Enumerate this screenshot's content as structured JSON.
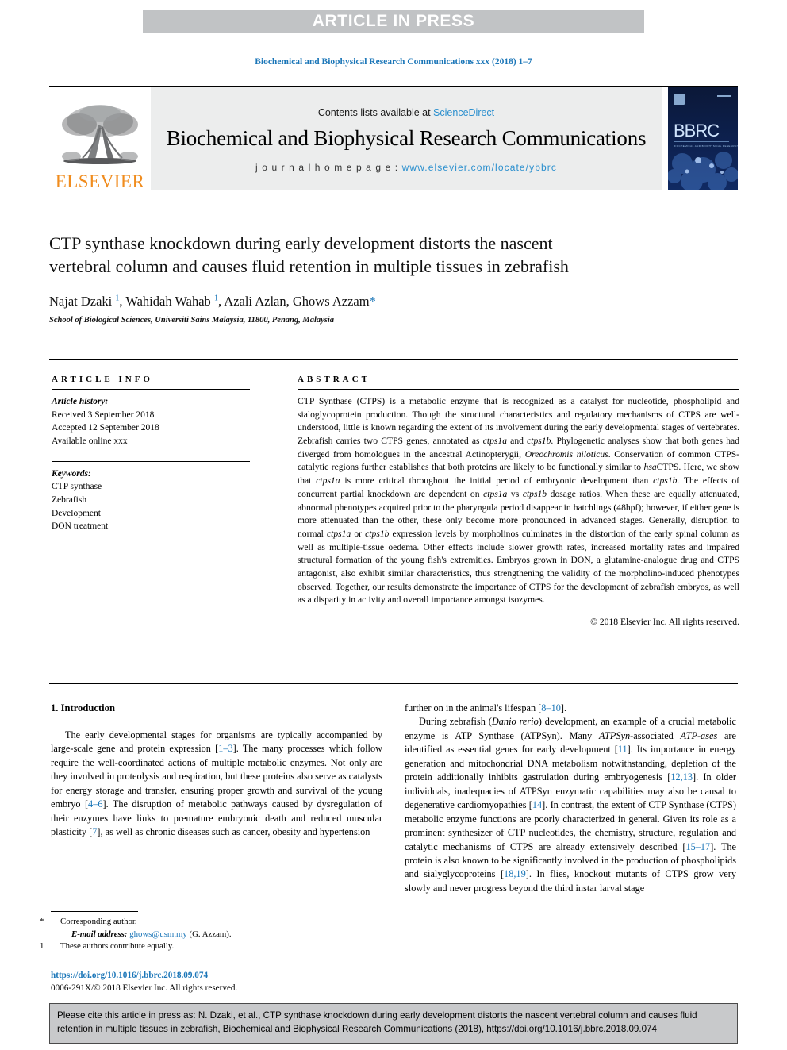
{
  "banner": {
    "text": "ARTICLE IN PRESS"
  },
  "journal_ref": "Biochemical and Biophysical Research Communications xxx (2018) 1–7",
  "masthead": {
    "contents_prefix": "Contents lists available at ",
    "sciencedirect": "ScienceDirect",
    "journal_title": "Biochemical and Biophysical Research Communications",
    "homepage_label": "j o u r n a l   h o m e p a g e :  ",
    "homepage_url": "www.elsevier.com/locate/ybbrc",
    "publisher": "ELSEVIER",
    "cover_title": "BBRC",
    "cover_subtitle": "BIOCHEMICAL AND BIOPHYSICAL RESEARCH COMMUNICATIONS",
    "accent_blue": "#2a8fce",
    "elsevier_orange": "#f08c1e"
  },
  "article": {
    "title": "CTP synthase knockdown during early development distorts the nascent vertebral column and causes fluid retention in multiple tissues in zebrafish",
    "authors_html": "Najat Dzaki <sup>1</sup>, Wahidah Wahab <sup>1</sup>, Azali Azlan, Ghows Azzam<span class=\"star\">*</span>",
    "affiliation": "School of Biological Sciences, Universiti Sains Malaysia, 11800, Penang, Malaysia"
  },
  "article_info": {
    "heading": "ARTICLE INFO",
    "history_label": "Article history:",
    "history": [
      "Received 3 September 2018",
      "Accepted 12 September 2018",
      "Available online xxx"
    ],
    "keywords_label": "Keywords:",
    "keywords": [
      "CTP synthase",
      "Zebrafish",
      "Development",
      "DON treatment"
    ]
  },
  "abstract": {
    "heading": "ABSTRACT",
    "text_html": "CTP Synthase (CTPS) is a metabolic enzyme that is recognized as a catalyst for nucleotide, phospholipid and sialoglycoprotein production. Though the structural characteristics and regulatory mechanisms of CTPS are well-understood, little is known regarding the extent of its involvement during the early developmental stages of vertebrates. Zebrafish carries two CTPS genes, annotated as <i>ctps1a</i> and <i>ctps1b</i>. Phylogenetic analyses show that both genes had diverged from homologues in the ancestral Actinopterygii, <i>Oreochromis niloticus</i>. Conservation of common CTPS-catalytic regions further establishes that both proteins are likely to be functionally similar to <i>hsa</i>CTPS. Here, we show that <i>ctps1a</i> is more critical throughout the initial period of embryonic development than <i>ctps1b</i>. The effects of concurrent partial knockdown are dependent on <i>ctps1a</i> vs <i>ctps1b</i> dosage ratios. When these are equally attenuated, abnormal phenotypes acquired prior to the pharyngula period disappear in hatchlings (48hpf); however, if either gene is more attenuated than the other, these only become more pronounced in advanced stages. Generally, disruption to normal <i>ctps1a</i> or <i>ctps1b</i> expression levels by morpholinos culminates in the distortion of the early spinal column as well as multiple-tissue oedema. Other effects include slower growth rates, increased mortality rates and impaired structural formation of the young fish's extremities. Embryos grown in DON, a glutamine-analogue drug and CTPS antagonist, also exhibit similar characteristics, thus strengthening the validity of the morpholino-induced phenotypes observed. Together, our results demonstrate the importance of CTPS for the development of zebrafish embryos, as well as a disparity in activity and overall importance amongst isozymes.",
    "copyright": "© 2018 Elsevier Inc. All rights reserved."
  },
  "introduction": {
    "heading": "1. Introduction",
    "left_paragraph_html": "The early developmental stages for organisms are typically accompanied by large-scale gene and protein expression [<span class=\"ref\">1–3</span>]. The many processes which follow require the well-coordinated actions of multiple metabolic enzymes. Not only are they involved in proteolysis and respiration, but these proteins also serve as catalysts for energy storage and transfer, ensuring proper growth and survival of the young embryo [<span class=\"ref\">4–6</span>]. The disruption of metabolic pathways caused by dysregulation of their enzymes have links to premature embryonic death and reduced muscular plasticity [<span class=\"ref\">7</span>], as well as chronic diseases such as cancer, obesity and hypertension",
    "right_paragraph_1_html": "further on in the animal's lifespan [<span class=\"ref\">8–10</span>].",
    "right_paragraph_2_html": "During zebrafish (<i>Danio rerio</i>) development, an example of a crucial metabolic enzyme is ATP Synthase (ATPSyn). Many <i>ATPSyn</i>-associated <i>ATP-ases</i> are identified as essential genes for early development [<span class=\"ref\">11</span>]. Its importance in energy generation and mitochondrial DNA metabolism notwithstanding, depletion of the protein additionally inhibits gastrulation during embryogenesis [<span class=\"ref\">12,13</span>]. In older individuals, inadequacies of ATPSyn enzymatic capabilities may also be causal to degenerative cardiomyopathies [<span class=\"ref\">14</span>]. In contrast, the extent of CTP Synthase (CTPS) metabolic enzyme functions are poorly characterized in general. Given its role as a prominent synthesizer of CTP nucleotides, the chemistry, structure, regulation and catalytic mechanisms of CTPS are already extensively described [<span class=\"ref\">15–17</span>]. The protein is also known to be significantly involved in the production of phospholipids and sialyglycoproteins [<span class=\"ref\">18,19</span>]. In flies, knockout mutants of CTPS grow very slowly and never progress beyond the third instar larval stage"
  },
  "footnotes": {
    "corresponding": "Corresponding author.",
    "email_label": "E-mail address:",
    "email": "ghows@usm.my",
    "email_suffix": "(G. Azzam).",
    "equal_contribution": "These authors contribute equally.",
    "star_mark": "*",
    "one_mark": "1",
    "doi": "https://doi.org/10.1016/j.bbrc.2018.09.074",
    "issn": "0006-291X/© 2018 Elsevier Inc. All rights reserved."
  },
  "cite_box": {
    "text": "Please cite this article in press as: N. Dzaki, et al., CTP synthase knockdown during early development distorts the nascent vertebral column and causes fluid retention in multiple tissues in zebrafish, Biochemical and Biophysical Research Communications (2018), https://doi.org/10.1016/j.bbrc.2018.09.074"
  }
}
